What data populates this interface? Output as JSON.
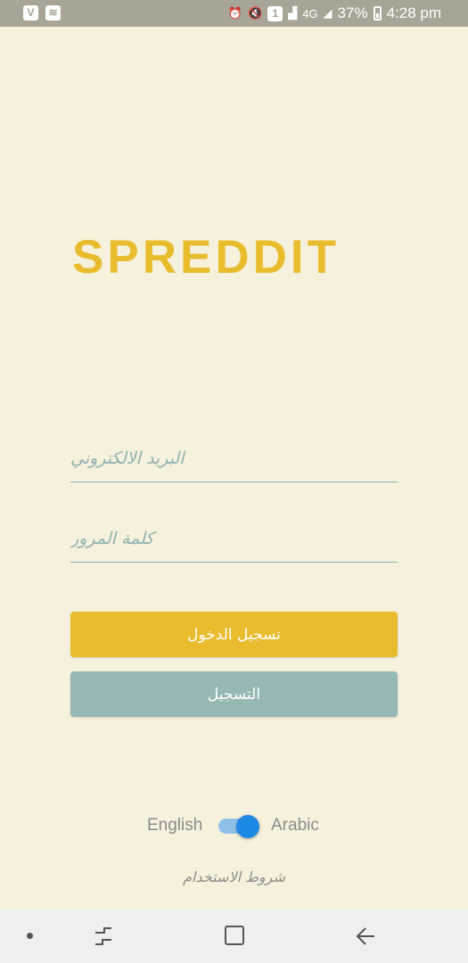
{
  "status_bar": {
    "left_icons": [
      "vivaldi-icon",
      "wifi-icon"
    ],
    "right_icons": [
      "alarm-icon",
      "mute-icon",
      "sim1-icon",
      "signal-icon",
      "4g-icon",
      "signal-weak-icon"
    ],
    "network_type": "4G",
    "battery": "37%",
    "time": "4:28 pm"
  },
  "app": {
    "logo": "SPREDDIT",
    "brand_color": "#e9bc2e"
  },
  "form": {
    "email_placeholder": "البريد الالكتروني",
    "email_value": "",
    "password_placeholder": "كلمة المرور",
    "password_value": ""
  },
  "buttons": {
    "login_label": "تسجيل الدخول",
    "login_color": "#e8bc2d",
    "signup_label": "التسجيل",
    "signup_color": "#96b8b4"
  },
  "language": {
    "left_label": "English",
    "right_label": "Arabic",
    "selected": "Arabic"
  },
  "footer": {
    "terms_label": "شروط الاستخدام"
  }
}
